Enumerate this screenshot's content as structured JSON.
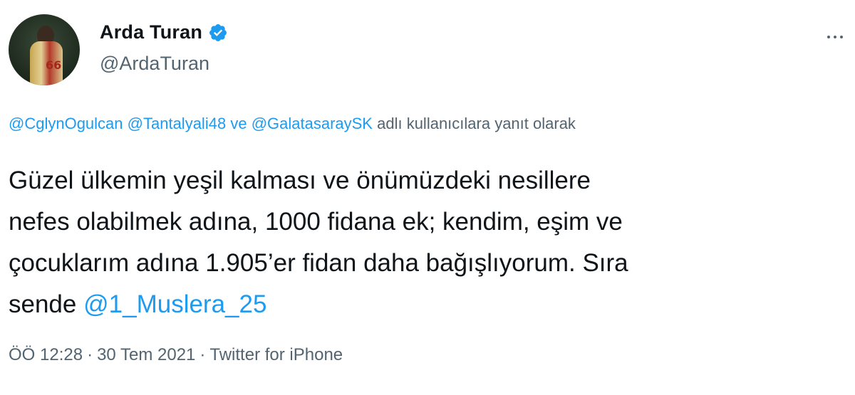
{
  "author": {
    "display_name": "Arda Turan",
    "handle": "@ArdaTuran",
    "verified_icon": "verified-badge-icon",
    "avatar_jersey_number": "66"
  },
  "reply_context": {
    "mentions": [
      "@CglynOgulcan",
      "@Tantalyali48",
      "@GalatasaraySK"
    ],
    "conjunction": "ve",
    "suffix": "adlı kullanıcılara yanıt olarak"
  },
  "tweet": {
    "lines": [
      "Güzel ülkemin yeşil kalması ve önümüzdeki nesillere",
      "nefes olabilmek adına, 1000 fidana ek; kendim, eşim ve",
      "çocuklarım adına 1.905’er fidan daha bağışlıyorum. Sıra"
    ],
    "last_line_prefix": "sende",
    "last_line_mention": "@1_Muslera_25"
  },
  "meta": {
    "time": "ÖÖ 12:28",
    "date": "30 Tem 2021",
    "source": "Twitter for iPhone",
    "separator": "·"
  },
  "colors": {
    "link": "#1d9bf0",
    "secondary": "#536471",
    "text": "#0f1419"
  }
}
